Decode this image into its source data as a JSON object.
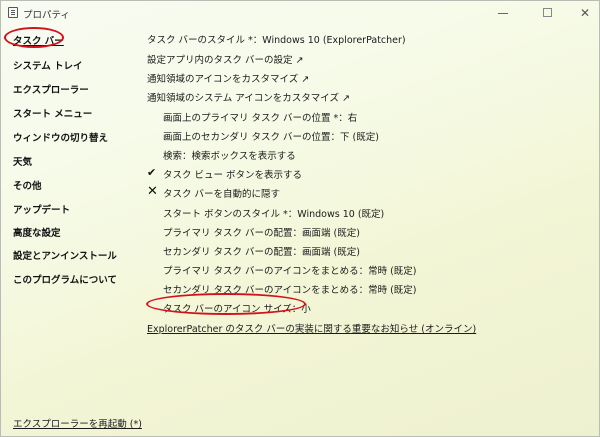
{
  "window": {
    "title": "プロパティ"
  },
  "sidebar": {
    "items": [
      {
        "label": "タスク バー",
        "active": true
      },
      {
        "label": "システム トレイ"
      },
      {
        "label": "エクスプローラー"
      },
      {
        "label": "スタート メニュー"
      },
      {
        "label": "ウィンドウの切り替え"
      },
      {
        "label": "天気"
      },
      {
        "label": "その他"
      },
      {
        "label": "アップデート"
      },
      {
        "label": "高度な設定"
      },
      {
        "label": "設定とアンインストール"
      },
      {
        "label": "このプログラムについて"
      }
    ],
    "restart_link": "エクスプローラーを再起動 (*)"
  },
  "settings": {
    "items": [
      {
        "label": "タスク バーのスタイル *：Windows 10 (ExplorerPatcher)"
      },
      {
        "label": "設定アプリ内のタスク バーの設定 ↗"
      },
      {
        "label": "通知領域のアイコンをカスタマイズ ↗"
      },
      {
        "label": "通知領域のシステム アイコンをカスタマイズ ↗"
      },
      {
        "label": "画面上のプライマリ タスク バーの位置 *：右"
      },
      {
        "label": "画面上のセカンダリ タスク バーの位置：下 (既定)"
      },
      {
        "label": "検索：検索ボックスを表示する"
      },
      {
        "label": "タスク ビュー ボタンを表示する",
        "checked": true
      },
      {
        "label": "タスク バーを自動的に隠す",
        "checked": false
      },
      {
        "label": "スタート ボタンのスタイル *：Windows 10 (既定)"
      },
      {
        "label": "プライマリ タスク バーの配置：画面端 (既定)"
      },
      {
        "label": "セカンダリ タスク バーの配置：画面端 (既定)"
      },
      {
        "label": "プライマリ タスク バーのアイコンをまとめる：常時 (既定)"
      },
      {
        "label": "セカンダリ タスク バーのアイコンをまとめる：常時 (既定)"
      },
      {
        "label": "タスク バーのアイコン サイズ：小"
      },
      {
        "label": "ExplorerPatcher のタスク バーの実装に関する重要なお知らせ (オンライン)"
      }
    ]
  },
  "colors": {
    "annotation": "#d3111a"
  },
  "icons": {
    "checked": "check-icon",
    "unchecked": "x-icon"
  }
}
